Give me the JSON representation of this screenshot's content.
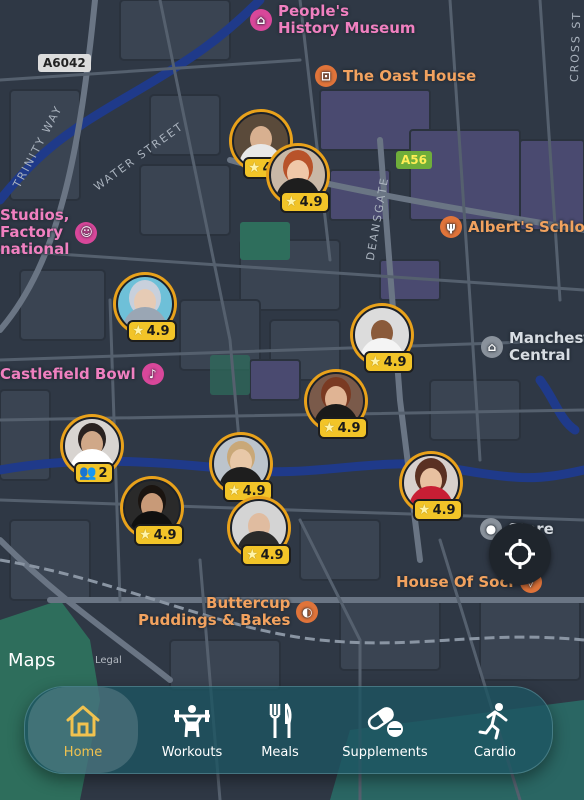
{
  "map": {
    "road_shields": [
      {
        "id": "a6042",
        "text": "A6042",
        "bg": "#dcdcdc",
        "fg": "#222222"
      },
      {
        "id": "a56",
        "text": "A56",
        "bg": "#6fae3a",
        "fg": "#ffee55"
      }
    ],
    "street_labels": {
      "trinity_way": "TRINITY WAY",
      "water_street": "WATER STREET",
      "deansgate": "DEANSGATE",
      "cross_st": "CROSS ST"
    },
    "pois": {
      "peoples_history": "People's\nHistory Museum",
      "oast_house": "The Oast House",
      "studios": "Studios,\nFactory\nnational",
      "alberts": "Albert's Schlos",
      "manchester_central": "Manchester\nCentral",
      "castlefield_bowl": "Castlefield Bowl",
      "house_of_social": "House Of Soci",
      "buttercup": "Buttercup\nPuddings & Bakes",
      "unlabeled_stop": "Store"
    },
    "trainers": [
      {
        "id": "t1",
        "rating": "4.9"
      },
      {
        "id": "t2",
        "rating": "4.9"
      },
      {
        "id": "t3",
        "rating": "4.9"
      },
      {
        "id": "t4",
        "rating": "4.9"
      },
      {
        "id": "t5",
        "rating": "4.9"
      },
      {
        "id": "group",
        "rating": "2"
      },
      {
        "id": "t6",
        "rating": "4.9"
      },
      {
        "id": "t7",
        "rating": "4.9"
      },
      {
        "id": "t8",
        "rating": "4.9"
      },
      {
        "id": "t9",
        "rating": "4.9"
      }
    ],
    "attribution": {
      "logo": "Maps",
      "legal": "Legal"
    }
  },
  "nav": {
    "items": [
      {
        "label": "Home",
        "icon": "home-icon",
        "active": true
      },
      {
        "label": "Workouts",
        "icon": "weightlifting-icon",
        "active": false
      },
      {
        "label": "Meals",
        "icon": "fork-knife-icon",
        "active": false
      },
      {
        "label": "Supplements",
        "icon": "pills-icon",
        "active": false
      },
      {
        "label": "Cardio",
        "icon": "running-icon",
        "active": false
      }
    ]
  },
  "colors": {
    "accent": "#f1c24f",
    "marker_ring": "#e9a21b",
    "rating_badge": "#f2c428",
    "map_bg": "#2f3845",
    "river": "#1f3a8a",
    "park": "#2e6e5c",
    "navbar": "#1c5462"
  }
}
